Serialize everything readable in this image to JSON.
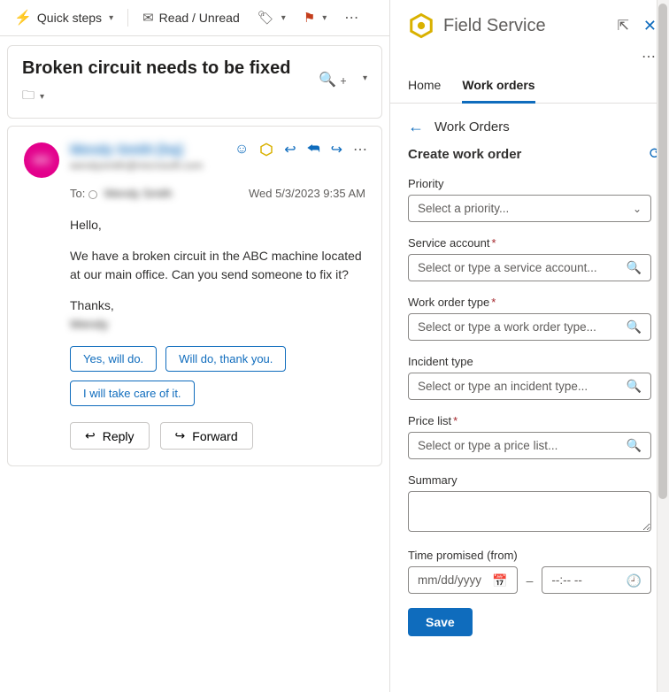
{
  "toolbar": {
    "quick_steps": "Quick steps",
    "read_unread": "Read / Unread"
  },
  "header": {
    "title": "Broken circuit needs to be fixed"
  },
  "email": {
    "sender_name": "Wendy Smith [hq]",
    "sender_email": "wendysmith@microsoft.com",
    "to_label": "To:",
    "to_name": "Wendy Smith",
    "timestamp": "Wed 5/3/2023 9:35 AM",
    "body_greeting": "Hello,",
    "body_main": "We have a broken circuit in the ABC machine located at   our main office. Can you send someone to fix it?",
    "body_thanks": "Thanks,",
    "body_sig": "Wendy",
    "suggestions": [
      "Yes, will do.",
      "Will do, thank you.",
      "I will take care of it."
    ],
    "reply": "Reply",
    "forward": "Forward"
  },
  "fs": {
    "app_title": "Field Service",
    "tabs": {
      "home": "Home",
      "work_orders": "Work orders"
    },
    "back_title": "Work Orders",
    "create_title": "Create work order",
    "fields": {
      "priority": {
        "label": "Priority",
        "placeholder": "Select a priority..."
      },
      "service_account": {
        "label": "Service account",
        "placeholder": "Select or type a service account..."
      },
      "work_order_type": {
        "label": "Work order type",
        "placeholder": "Select or type a work order type..."
      },
      "incident_type": {
        "label": "Incident type",
        "placeholder": "Select or type an incident type..."
      },
      "price_list": {
        "label": "Price list",
        "placeholder": "Select or type a price list..."
      },
      "summary": {
        "label": "Summary"
      },
      "time_promised": {
        "label": "Time promised (from)",
        "date_placeholder": "mm/dd/yyyy",
        "time_placeholder": "--:--  --"
      }
    },
    "save": "Save"
  }
}
